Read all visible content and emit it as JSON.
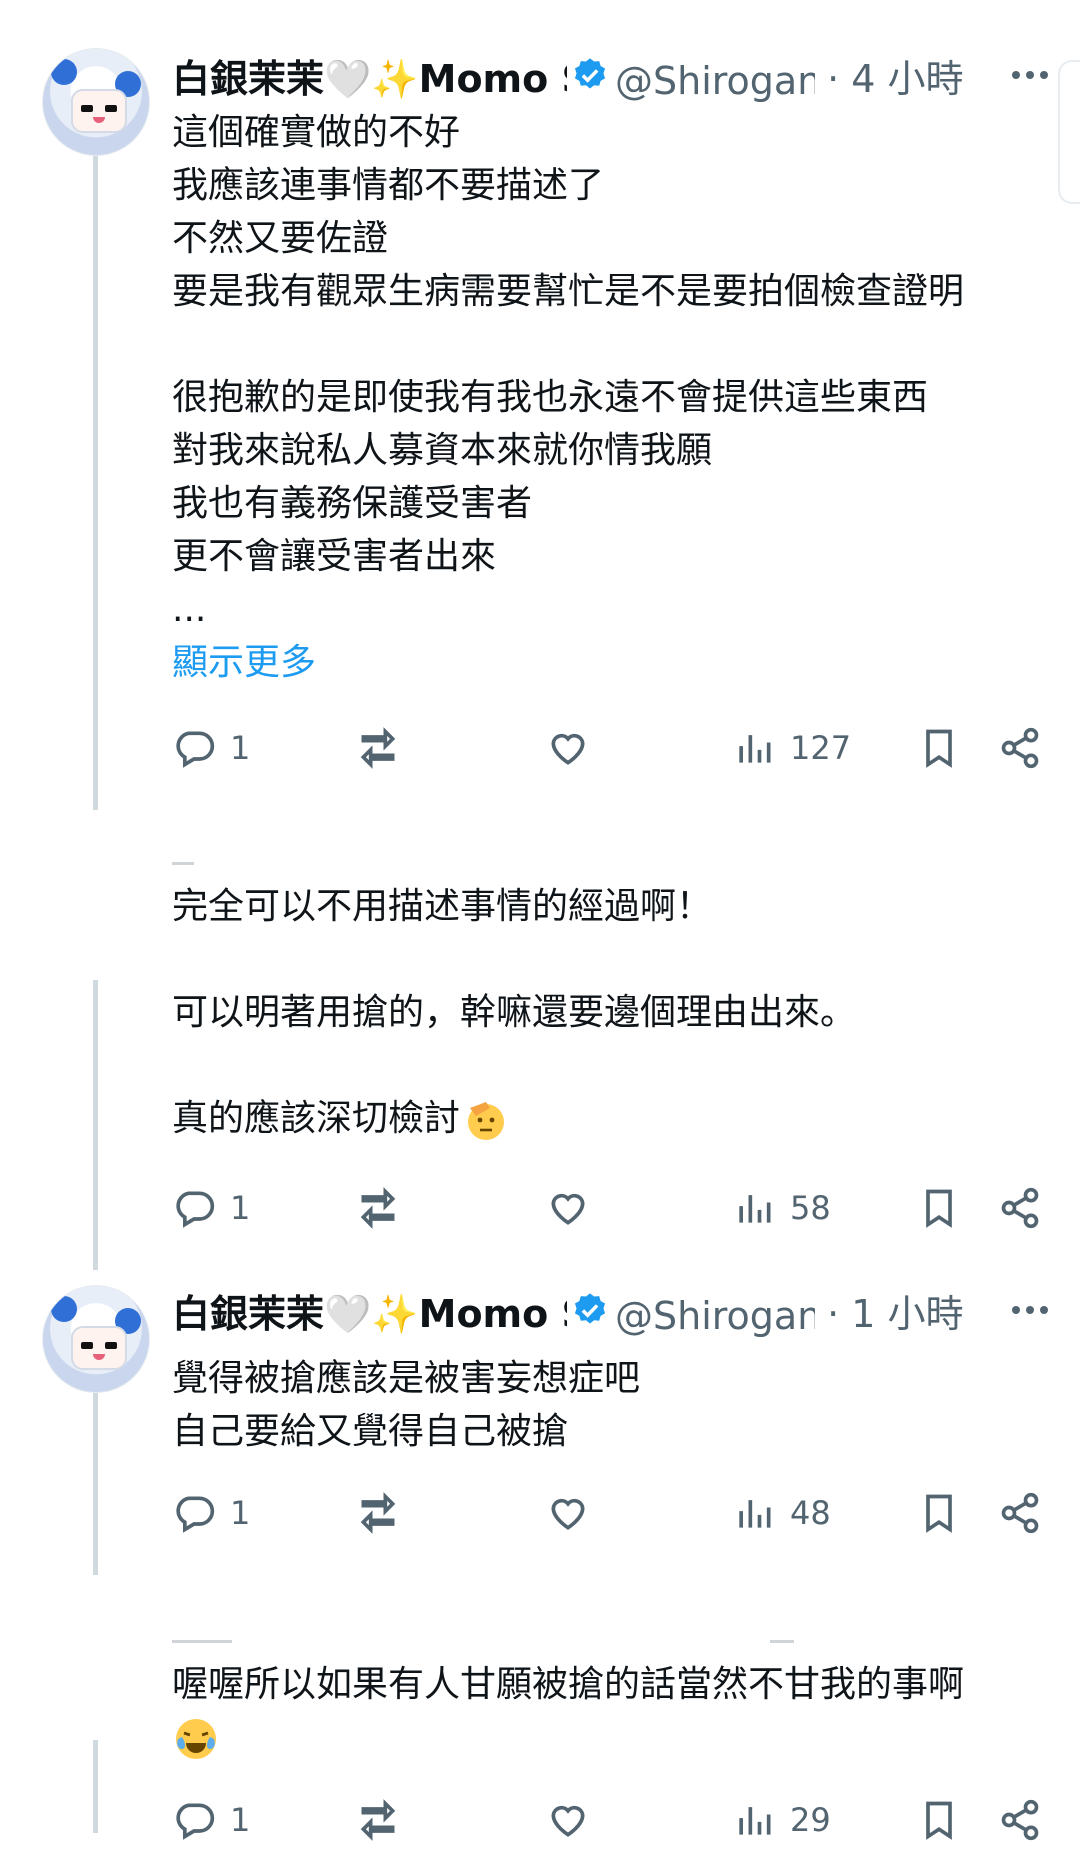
{
  "tweets": [
    {
      "display_name": "白銀茉茉🤍✨Momo S",
      "handle": "@Shirogane",
      "time": "· 4 小時",
      "lines": [
        "這個確實做的不好",
        "我應該連事情都不要描述了",
        "不然又要佐證",
        "要是我有觀眾生病需要幫忙是不是要拍個檢查證明",
        "",
        "很抱歉的是即使我有我也永遠不會提供這些東西",
        "對我來說私人募資本來就你情我願",
        "我也有義務保護受害者",
        "更不會讓受害者出來",
        "..."
      ],
      "show_more": "顯示更多",
      "replies": "1",
      "views": "127"
    },
    {
      "lines": [
        "完全可以不用描述事情的經過啊！",
        "",
        "可以明著用搶的，幹嘛還要邊個理由出來。",
        "",
        "真的應該深切檢討"
      ],
      "emoji": "saluting-face-emoji",
      "replies": "1",
      "views": "58"
    },
    {
      "display_name": "白銀茉茉🤍✨Momo S",
      "handle": "@Shirogane",
      "time": "· 1 小時",
      "lines": [
        "覺得被搶應該是被害妄想症吧",
        "自己要給又覺得自己被搶"
      ],
      "replies": "1",
      "views": "48"
    },
    {
      "lines": [
        "喔喔所以如果有人甘願被搶的話當然不甘我的事啊"
      ],
      "emoji": "face-with-tears-of-joy-emoji",
      "replies": "1",
      "views": "29"
    }
  ],
  "colors": {
    "text": "#0f1419",
    "secondary": "#536471",
    "link": "#1d9bf0",
    "verified": "#1d9bf0",
    "thread_line": "#cfd9de"
  },
  "icons": [
    "reply-icon",
    "retweet-icon",
    "like-icon",
    "views-icon",
    "bookmark-icon",
    "share-icon",
    "more-icon",
    "verified-badge-icon"
  ]
}
